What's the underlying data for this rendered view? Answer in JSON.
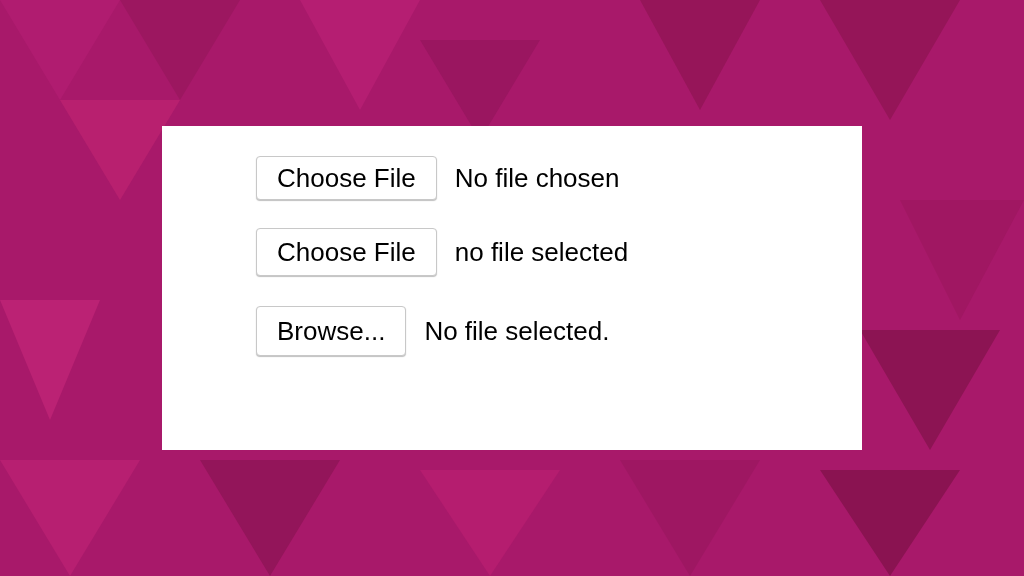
{
  "file_inputs": [
    {
      "button": "Choose File",
      "status": "No file chosen"
    },
    {
      "button": "Choose File",
      "status": "no file selected"
    },
    {
      "button": "Browse...",
      "status": "No file selected."
    }
  ]
}
